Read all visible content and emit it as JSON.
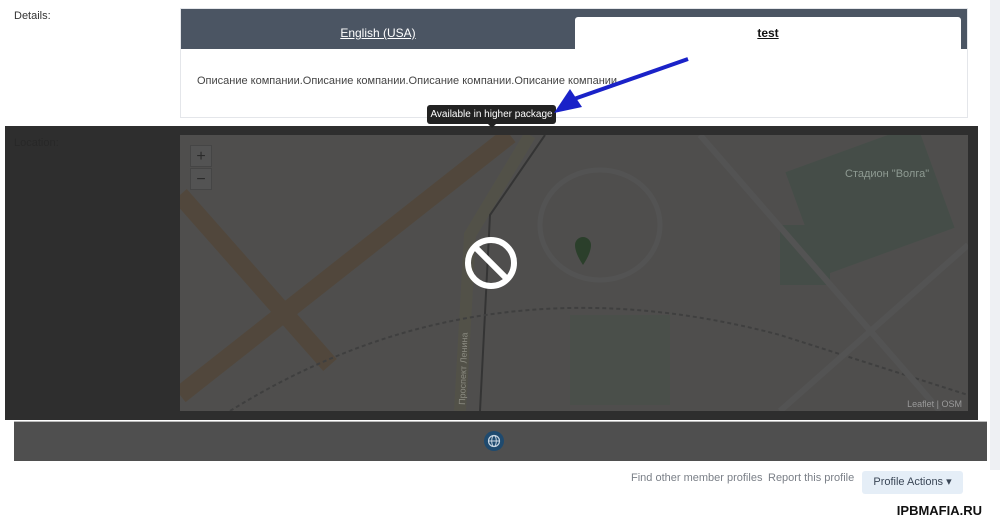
{
  "details": {
    "label": "Details:",
    "tabs": [
      {
        "label": "English (USA)",
        "active": false
      },
      {
        "label": "test",
        "active": true
      }
    ],
    "description": "Описание компании.Описание компании.Описание компании.Описание компании."
  },
  "tooltip": "Available in higher package",
  "location": {
    "label": "Location:",
    "zoom_in": "+",
    "zoom_out": "−",
    "attribution": "Leaflet | OSM",
    "map_labels": {
      "stadium": "Стадион \"Волга\"",
      "avenue": "Проспект Ленина"
    },
    "locked_icon": "block-icon"
  },
  "bottom_icon": "globe-icon",
  "footer": {
    "find_link": "Find other member profiles",
    "report_link": "Report this profile",
    "actions_button": "Profile Actions ▾"
  },
  "watermark": "IPBMAFIA.RU",
  "colors": {
    "tab_bar": "#4b5563",
    "arrow": "#1a22c8",
    "actions_bg": "#e5eef7"
  }
}
